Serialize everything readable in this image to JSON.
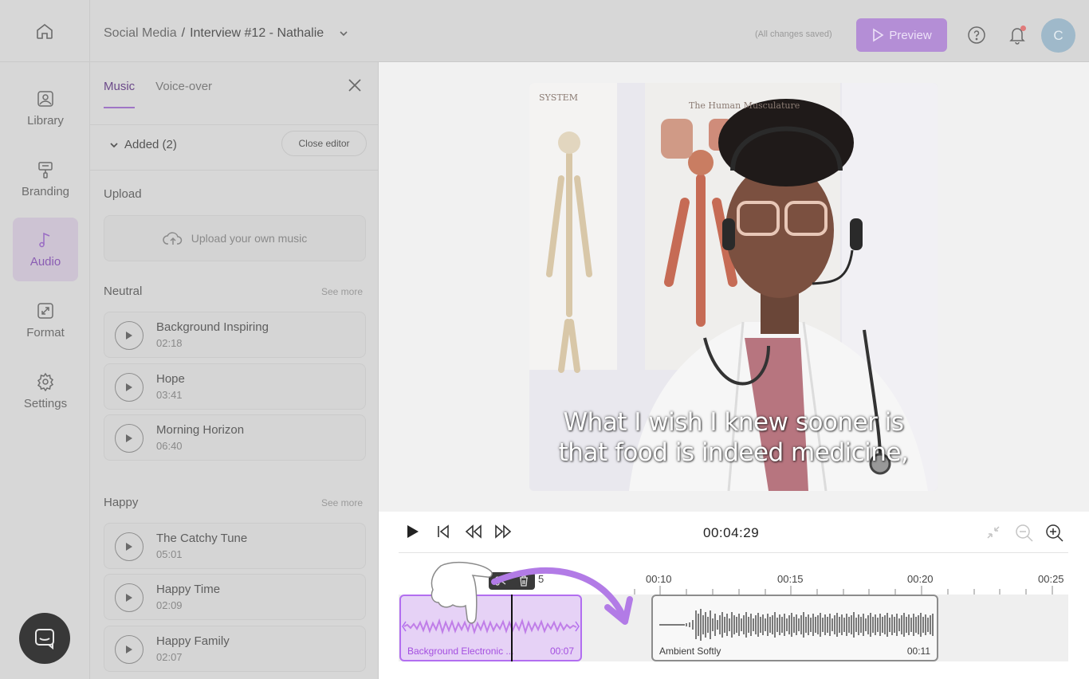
{
  "header": {
    "breadcrumb_parent": "Social Media",
    "breadcrumb_sep": "/",
    "breadcrumb_current": "Interview #12 - Nathalie",
    "saved_status": "(All changes saved)",
    "preview_label": "Preview",
    "avatar_initial": "C"
  },
  "nav": {
    "items": [
      {
        "label": "Library",
        "icon": "image-icon"
      },
      {
        "label": "Branding",
        "icon": "paint-roller-icon"
      },
      {
        "label": "Audio",
        "icon": "music-note-icon"
      },
      {
        "label": "Format",
        "icon": "resize-icon"
      },
      {
        "label": "Settings",
        "icon": "gear-icon"
      }
    ]
  },
  "panel": {
    "tabs": [
      "Music",
      "Voice-over"
    ],
    "added_label": "Added (2)",
    "close_editor_label": "Close editor",
    "upload_title": "Upload",
    "upload_button": "Upload your own music",
    "see_more": "See more",
    "sections": [
      {
        "title": "Neutral",
        "tracks": [
          {
            "name": "Background Inspiring",
            "duration": "02:18"
          },
          {
            "name": "Hope",
            "duration": "03:41"
          },
          {
            "name": "Morning Horizon",
            "duration": "06:40"
          }
        ]
      },
      {
        "title": "Happy",
        "tracks": [
          {
            "name": "The Catchy Tune",
            "duration": "05:01"
          },
          {
            "name": "Happy Time",
            "duration": "02:09"
          },
          {
            "name": "Happy Family",
            "duration": "02:07"
          }
        ]
      }
    ]
  },
  "video": {
    "subtitle_line1": "What I wish I knew sooner is",
    "subtitle_line2": "that food is indeed medicine,",
    "poster_title_1": "SYSTEM",
    "poster_title_2": "The Human Musculature"
  },
  "timeline": {
    "current_time": "00:04:29",
    "ticks": [
      "5",
      "00:10",
      "00:15",
      "00:20",
      "00:25"
    ],
    "clips": [
      {
        "name": "Background Electronic ...",
        "duration": "00:07"
      },
      {
        "name": "Ambient Softly",
        "duration": "00:11"
      }
    ]
  },
  "colors": {
    "accent": "#b48ed6",
    "clip_selected_border": "#b26ef0",
    "clip_selected_fill": "#e6d2f6"
  }
}
